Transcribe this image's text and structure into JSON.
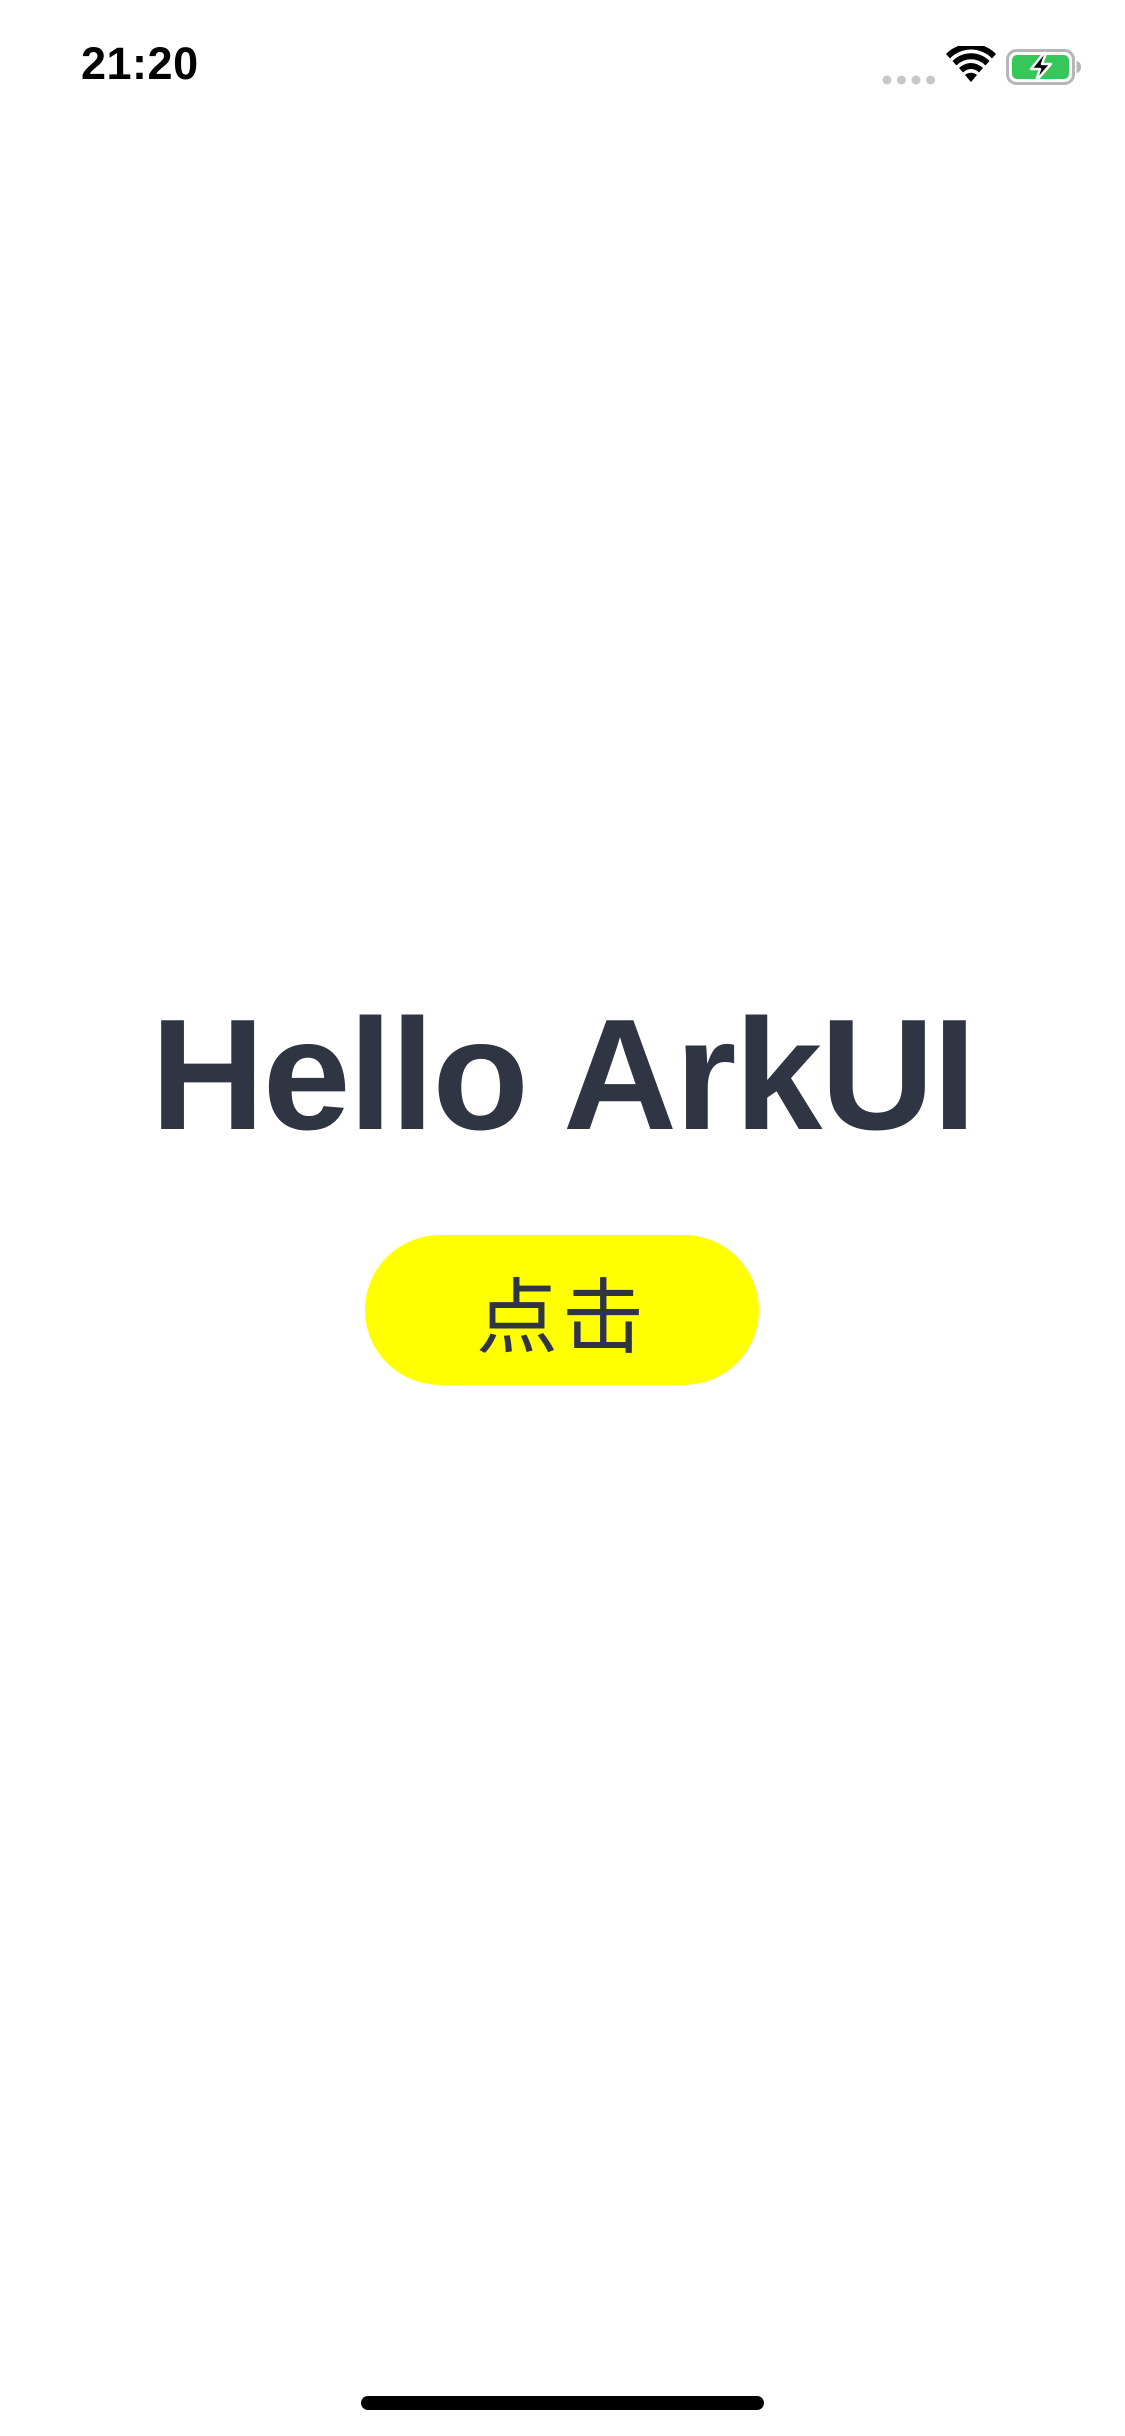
{
  "status_bar": {
    "time": "21:20",
    "icons": [
      "signal-icon",
      "wifi-icon",
      "battery-charging-icon"
    ],
    "battery_color": "#35c759"
  },
  "main": {
    "title": "Hello ArkUI",
    "title_color": "#2f3542",
    "button": {
      "label": "点击",
      "background": "#ffff00"
    }
  }
}
